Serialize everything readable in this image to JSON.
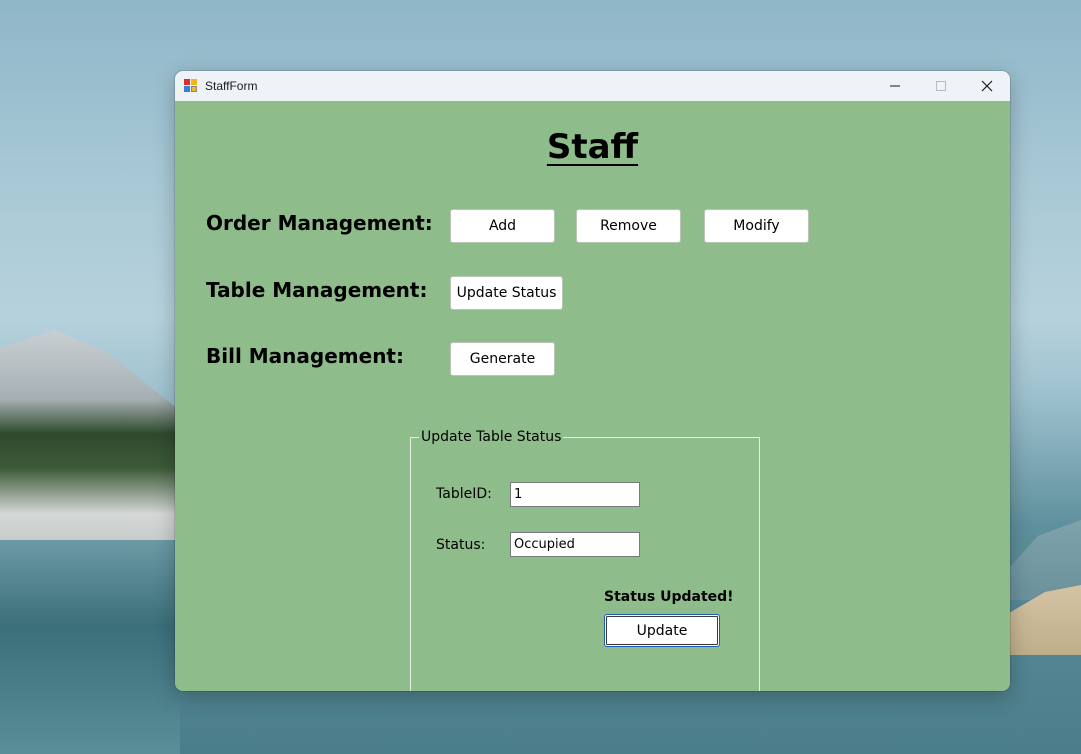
{
  "window": {
    "title": "StaffForm",
    "icon": "app-form-icon",
    "controls": [
      "minimize-icon",
      "maximize-icon",
      "close-icon"
    ]
  },
  "page": {
    "title": "Staff"
  },
  "sections": {
    "order": {
      "label": "Order Management:",
      "buttons": [
        "Add",
        "Remove",
        "Modify"
      ]
    },
    "table": {
      "label": "Table Management:",
      "buttons": [
        "Update Status"
      ]
    },
    "bill": {
      "label": "Bill Management:",
      "buttons": [
        "Generate"
      ]
    }
  },
  "update_panel": {
    "legend": "Update Table Status",
    "table_id_label": "TableID:",
    "table_id_value": "1",
    "status_label": "Status:",
    "status_value": "Occupied",
    "message": "Status Updated!",
    "update_button": "Update"
  },
  "colors": {
    "form_background": "#8fbc8b",
    "titlebar": "#eef3f8",
    "button_background": "#ffffff"
  }
}
